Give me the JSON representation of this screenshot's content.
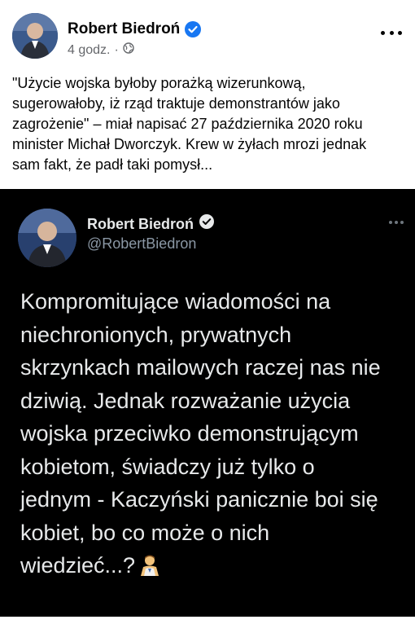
{
  "post": {
    "author": "Robert Biedroń",
    "time": "4 godz.",
    "separator": "·",
    "text": "\"Użycie wojska byłoby porażką wizerunkową,\nsugerowałoby, iż rząd traktuje demonstrantów jako\nzagrożenie\" – miał napisać 27 października 2020 roku\nminister Michał Dworczyk. Krew w żyłach mrozi jednak\nsam fakt, że padł taki pomysł..."
  },
  "tweet": {
    "name": "Robert Biedroń",
    "handle": "@RobertBiedron",
    "text": "Kompromitujące wiadomości na\nniechronionych, prywatnych\nskrzynkach mailowych raczej nas nie\ndziwią. Jednak rozważanie użycia\nwojska przeciwko demonstrującym\nkobietom, świadczy już tylko o\njednym - Kaczyński panicznie boi się\nkobiet, bo co może o nich\nwiedzieć...?"
  },
  "icons": {
    "verified": "verified-badge-icon",
    "globe": "globe-icon",
    "more": "more-options-icon",
    "emoji": "man-shrugging-emoji"
  },
  "colors": {
    "verified_fb": "#1877f2",
    "tweet_bg": "#000000",
    "tweet_text": "#e7e9ea",
    "muted": "#65676b"
  }
}
